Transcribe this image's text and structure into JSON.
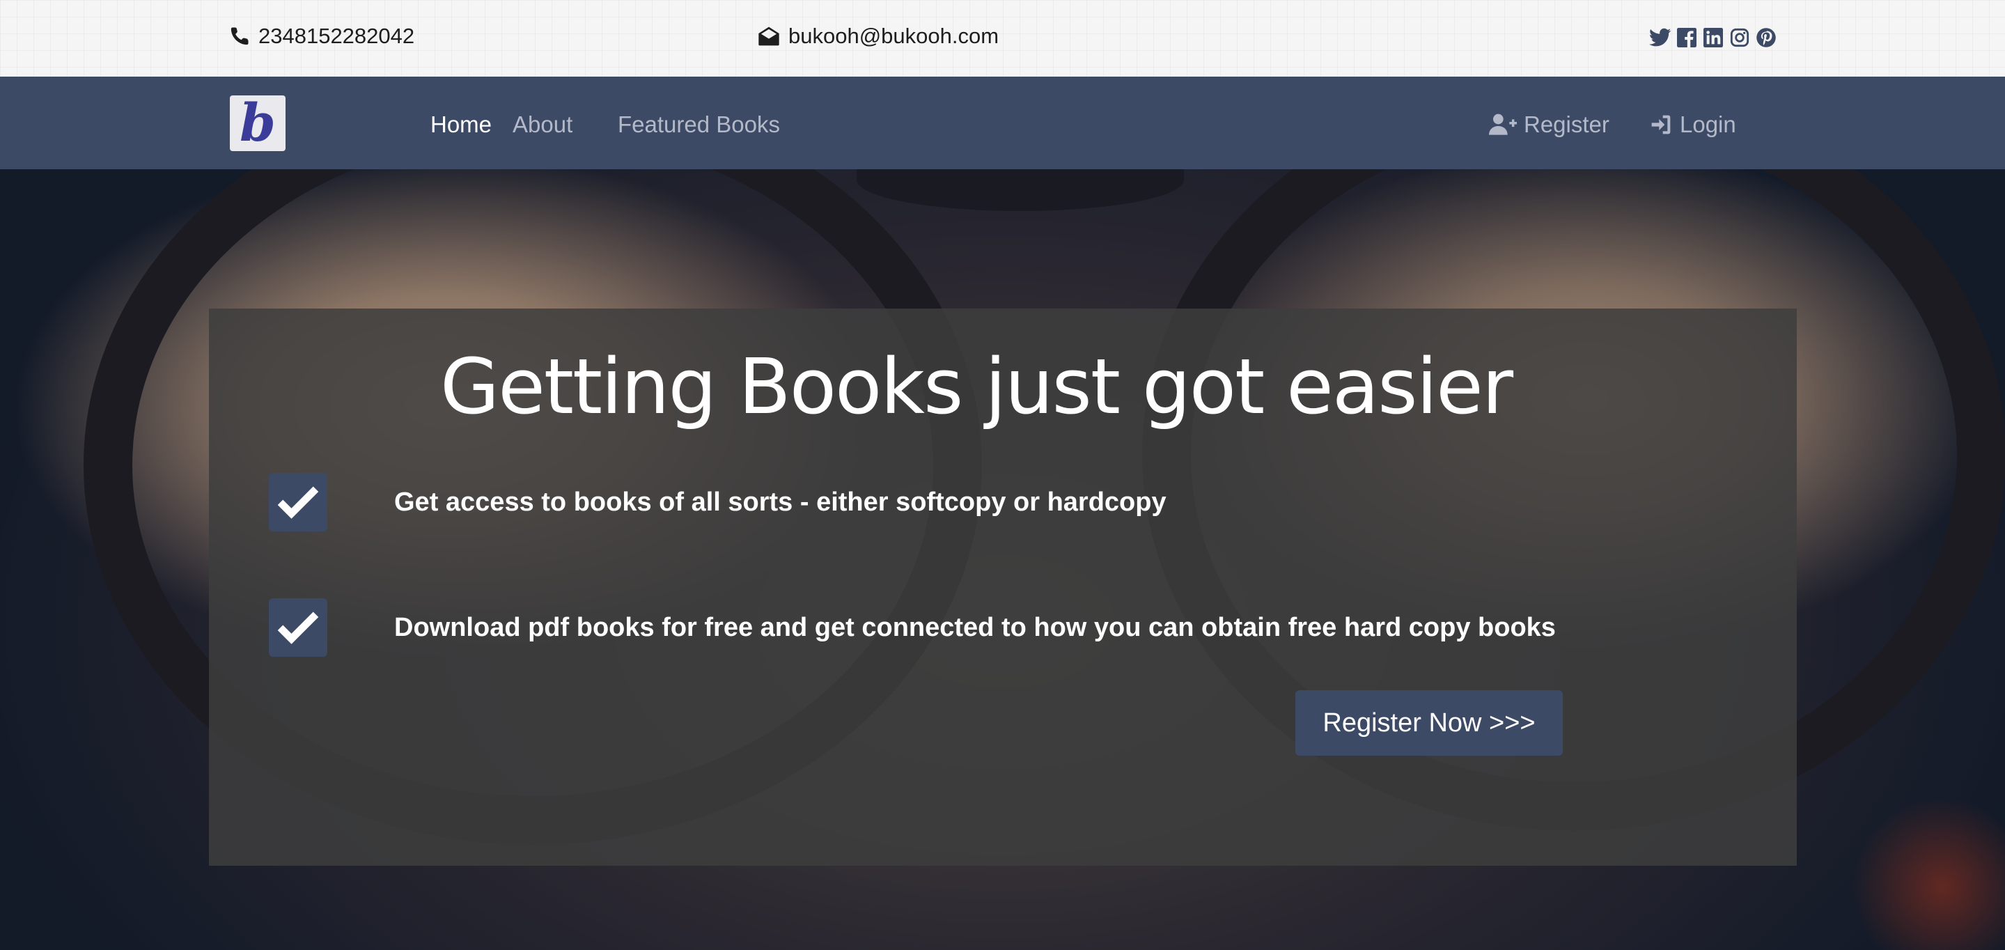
{
  "topbar": {
    "phone": "2348152282042",
    "email": "bukooh@bukooh.com",
    "social_icons": [
      "twitter-icon",
      "facebook-icon",
      "linkedin-icon",
      "instagram-icon",
      "pinterest-icon"
    ]
  },
  "navbar": {
    "logo_letter": "b",
    "links": [
      {
        "label": "Home",
        "active": true
      },
      {
        "label": "About",
        "active": false
      },
      {
        "label": "Featured Books",
        "active": false
      }
    ],
    "register_label": "Register",
    "login_label": "Login"
  },
  "hero": {
    "title": "Getting Books just got easier",
    "features": [
      "Get access to books of all sorts - either softcopy or hardcopy",
      "Download pdf books for free and get connected to how you can obtain free hard copy books"
    ],
    "cta_label": "Register Now >>>"
  },
  "colors": {
    "nav_bg": "#3d4a66",
    "topbar_bg": "#f5f5f5",
    "panel_bg": "#3e3e3e",
    "nav_link_inactive": "#b3b9c8"
  }
}
